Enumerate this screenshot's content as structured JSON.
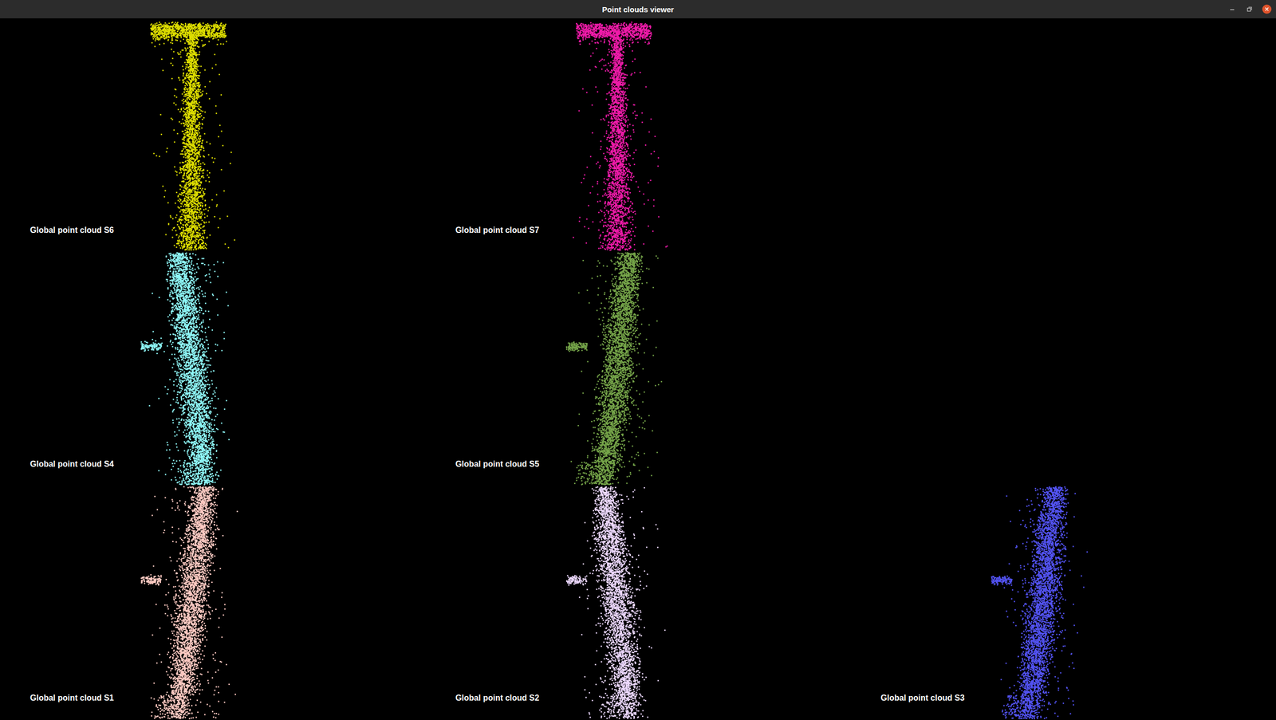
{
  "window": {
    "title": "Point clouds viewer"
  },
  "viewport_rows": [
    [
      {
        "label": "Global point cloud S6",
        "color": "#dcdc00",
        "kind": "t-bar"
      },
      {
        "label": "Global point cloud S7",
        "color": "#ee1aa8",
        "kind": "t-bar"
      }
    ],
    [
      {
        "label": "Global point cloud S4",
        "color": "#8ef8f8",
        "kind": "column"
      },
      {
        "label": "Global point cloud S5",
        "color": "#74a348",
        "kind": "column"
      }
    ],
    [
      {
        "label": "Global point cloud S1",
        "color": "#ffcac2",
        "kind": "column"
      },
      {
        "label": "Global point cloud S2",
        "color": "#ead6fb",
        "kind": "column"
      },
      {
        "label": "Global point cloud S3",
        "color": "#5252f2",
        "kind": "column"
      }
    ]
  ]
}
